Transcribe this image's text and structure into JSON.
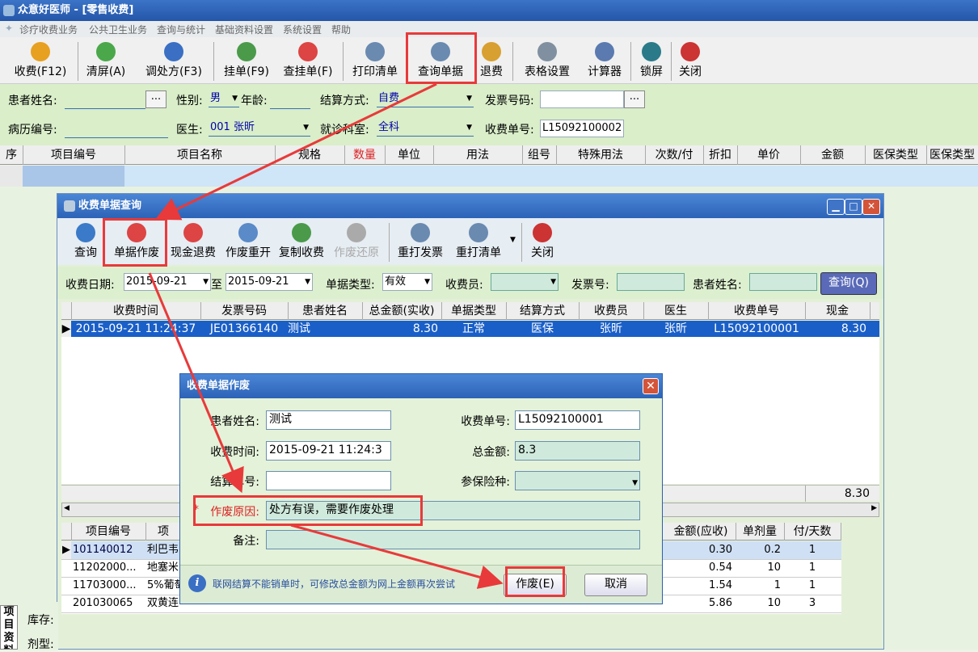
{
  "window": {
    "title": "众意好医师 - [零售收费]"
  },
  "menu": [
    "诊疗收费业务",
    "公共卫生业务",
    "查询与统计",
    "基础资料设置",
    "系统设置",
    "帮助"
  ],
  "toolbar": [
    {
      "label": "收费(F12)",
      "icon": "yuan-coin-icon",
      "color": "#e8a020"
    },
    {
      "label": "清屏(A)",
      "icon": "refresh-icon",
      "color": "#4aa84a"
    },
    {
      "label": "调处方(F3)",
      "icon": "people-icon",
      "color": "#3a6fc4"
    },
    {
      "label": "挂单(F9)",
      "icon": "hang-icon",
      "color": "#4a9a4a"
    },
    {
      "label": "查挂单(F)",
      "icon": "search-hang-icon",
      "color": "#d44"
    },
    {
      "label": "打印清单",
      "icon": "printer-icon",
      "color": "#6a8ab0"
    },
    {
      "label": "查询单据",
      "icon": "query-doc-icon",
      "color": "#6a8ab0"
    },
    {
      "label": "退费",
      "icon": "coins-icon",
      "color": "#d8a030"
    },
    {
      "label": "表格设置",
      "icon": "gear-icon",
      "color": "#8090a0"
    },
    {
      "label": "计算器",
      "icon": "calculator-icon",
      "color": "#5a7ab0"
    },
    {
      "label": "锁屏",
      "icon": "monitor-icon",
      "color": "#2a7a8a"
    },
    {
      "label": "关闭",
      "icon": "exit-icon",
      "color": "#c33"
    }
  ],
  "patient": {
    "name_label": "患者姓名:",
    "name_value": "",
    "gender_label": "性别:",
    "gender_value": "男",
    "age_label": "年龄:",
    "age_value": "",
    "settle_label": "结算方式:",
    "settle_value": "自费",
    "invoice_label": "发票号码:",
    "invoice_value": "",
    "record_label": "病历编号:",
    "record_value": "",
    "doctor_label": "医生:",
    "doctor_value": "001 张昕",
    "dept_label": "就诊科室:",
    "dept_value": "全科",
    "charge_no_label": "收费单号:",
    "charge_no_value": "L15092100002",
    "ellipsis": "..."
  },
  "main_grid": {
    "headers": [
      "序",
      "项目编号",
      "项目名称",
      "规格",
      "数量",
      "单位",
      "用法",
      "组号",
      "特殊用法",
      "次数/付",
      "折扣",
      "单价",
      "金额",
      "医保类型",
      "医保类型"
    ]
  },
  "query_window": {
    "title": "收费单据查询",
    "toolbar": [
      {
        "label": "查询",
        "icon": "magnifier-icon",
        "color": "#3a7ac8",
        "disabled": false
      },
      {
        "label": "单据作废",
        "icon": "hand-stop-icon",
        "color": "#d44",
        "disabled": false
      },
      {
        "label": "现金退费",
        "icon": "hand-cash-icon",
        "color": "#d44",
        "disabled": false
      },
      {
        "label": "作废重开",
        "icon": "edit-doc-icon",
        "color": "#5a8ac8",
        "disabled": false
      },
      {
        "label": "复制收费",
        "icon": "copy-icon",
        "color": "#4a9a4a",
        "disabled": false
      },
      {
        "label": "作废还原",
        "icon": "circle-icon",
        "color": "#aaa",
        "disabled": true
      },
      {
        "label": "重打发票",
        "icon": "printer-icon",
        "color": "#6a8ab0",
        "disabled": false
      },
      {
        "label": "重打清单",
        "icon": "printer-icon",
        "color": "#6a8ab0",
        "disabled": false
      },
      {
        "label": "关闭",
        "icon": "exit-icon",
        "color": "#c33",
        "disabled": false
      }
    ],
    "filter": {
      "date_label": "收费日期:",
      "date_from": "2015-09-21",
      "to_label": "至",
      "date_to": "2015-09-21",
      "type_label": "单据类型:",
      "type_value": "有效",
      "cashier_label": "收费员:",
      "cashier_value": "",
      "invoice_label": "发票号:",
      "invoice_value": "",
      "patient_label": "患者姓名:",
      "patient_value": "",
      "query_button": "查询(Q)"
    },
    "grid": {
      "headers": [
        "收费时间",
        "发票号码",
        "患者姓名",
        "总金额(实收)",
        "单据类型",
        "结算方式",
        "收费员",
        "医生",
        "收费单号",
        "现金"
      ],
      "rows": [
        [
          "2015-09-21 11:24:37",
          "JE01366140",
          "测试",
          "8.30",
          "正常",
          "医保",
          "张昕",
          "张昕",
          "L15092100001",
          "8.30"
        ]
      ],
      "total": "8.30"
    },
    "detail": {
      "headers": [
        "项目编号",
        "项",
        "金额(应收)",
        "单剂量",
        "付/天数"
      ],
      "rows": [
        [
          "101140012",
          "利巴韦",
          "0.30",
          "0.2",
          "1"
        ],
        [
          "11202000...",
          "地塞米",
          "0.54",
          "10",
          "1"
        ],
        [
          "11703000...",
          "5%葡萄",
          "1.54",
          "1",
          "1"
        ],
        [
          "201030065",
          "双黄连",
          "5.86",
          "10",
          "3"
        ]
      ]
    }
  },
  "void_dialog": {
    "title": "收费单据作废",
    "patient_label": "患者姓名:",
    "patient_value": "测试",
    "charge_no_label": "收费单号:",
    "charge_no_value": "L15092100001",
    "time_label": "收费时间:",
    "time_value": "2015-09-21 11:24:3",
    "total_label": "总金额:",
    "total_value": "8.3",
    "settle_no_label": "结算单号:",
    "settle_no_value": "",
    "insurance_label": "参保险种:",
    "insurance_value": "",
    "reason_label": "作废原因:",
    "reason_value": "处方有误，需要作废处理",
    "note_label": "备注:",
    "note_value": "",
    "info": "联网结算不能销单时，可修改总金额为网上金额再次尝试",
    "void_button": "作废(E)",
    "cancel_button": "取消"
  },
  "side_panel": {
    "tab": "项目资料",
    "stock_label": "库存:",
    "dose_label": "剂型:"
  }
}
